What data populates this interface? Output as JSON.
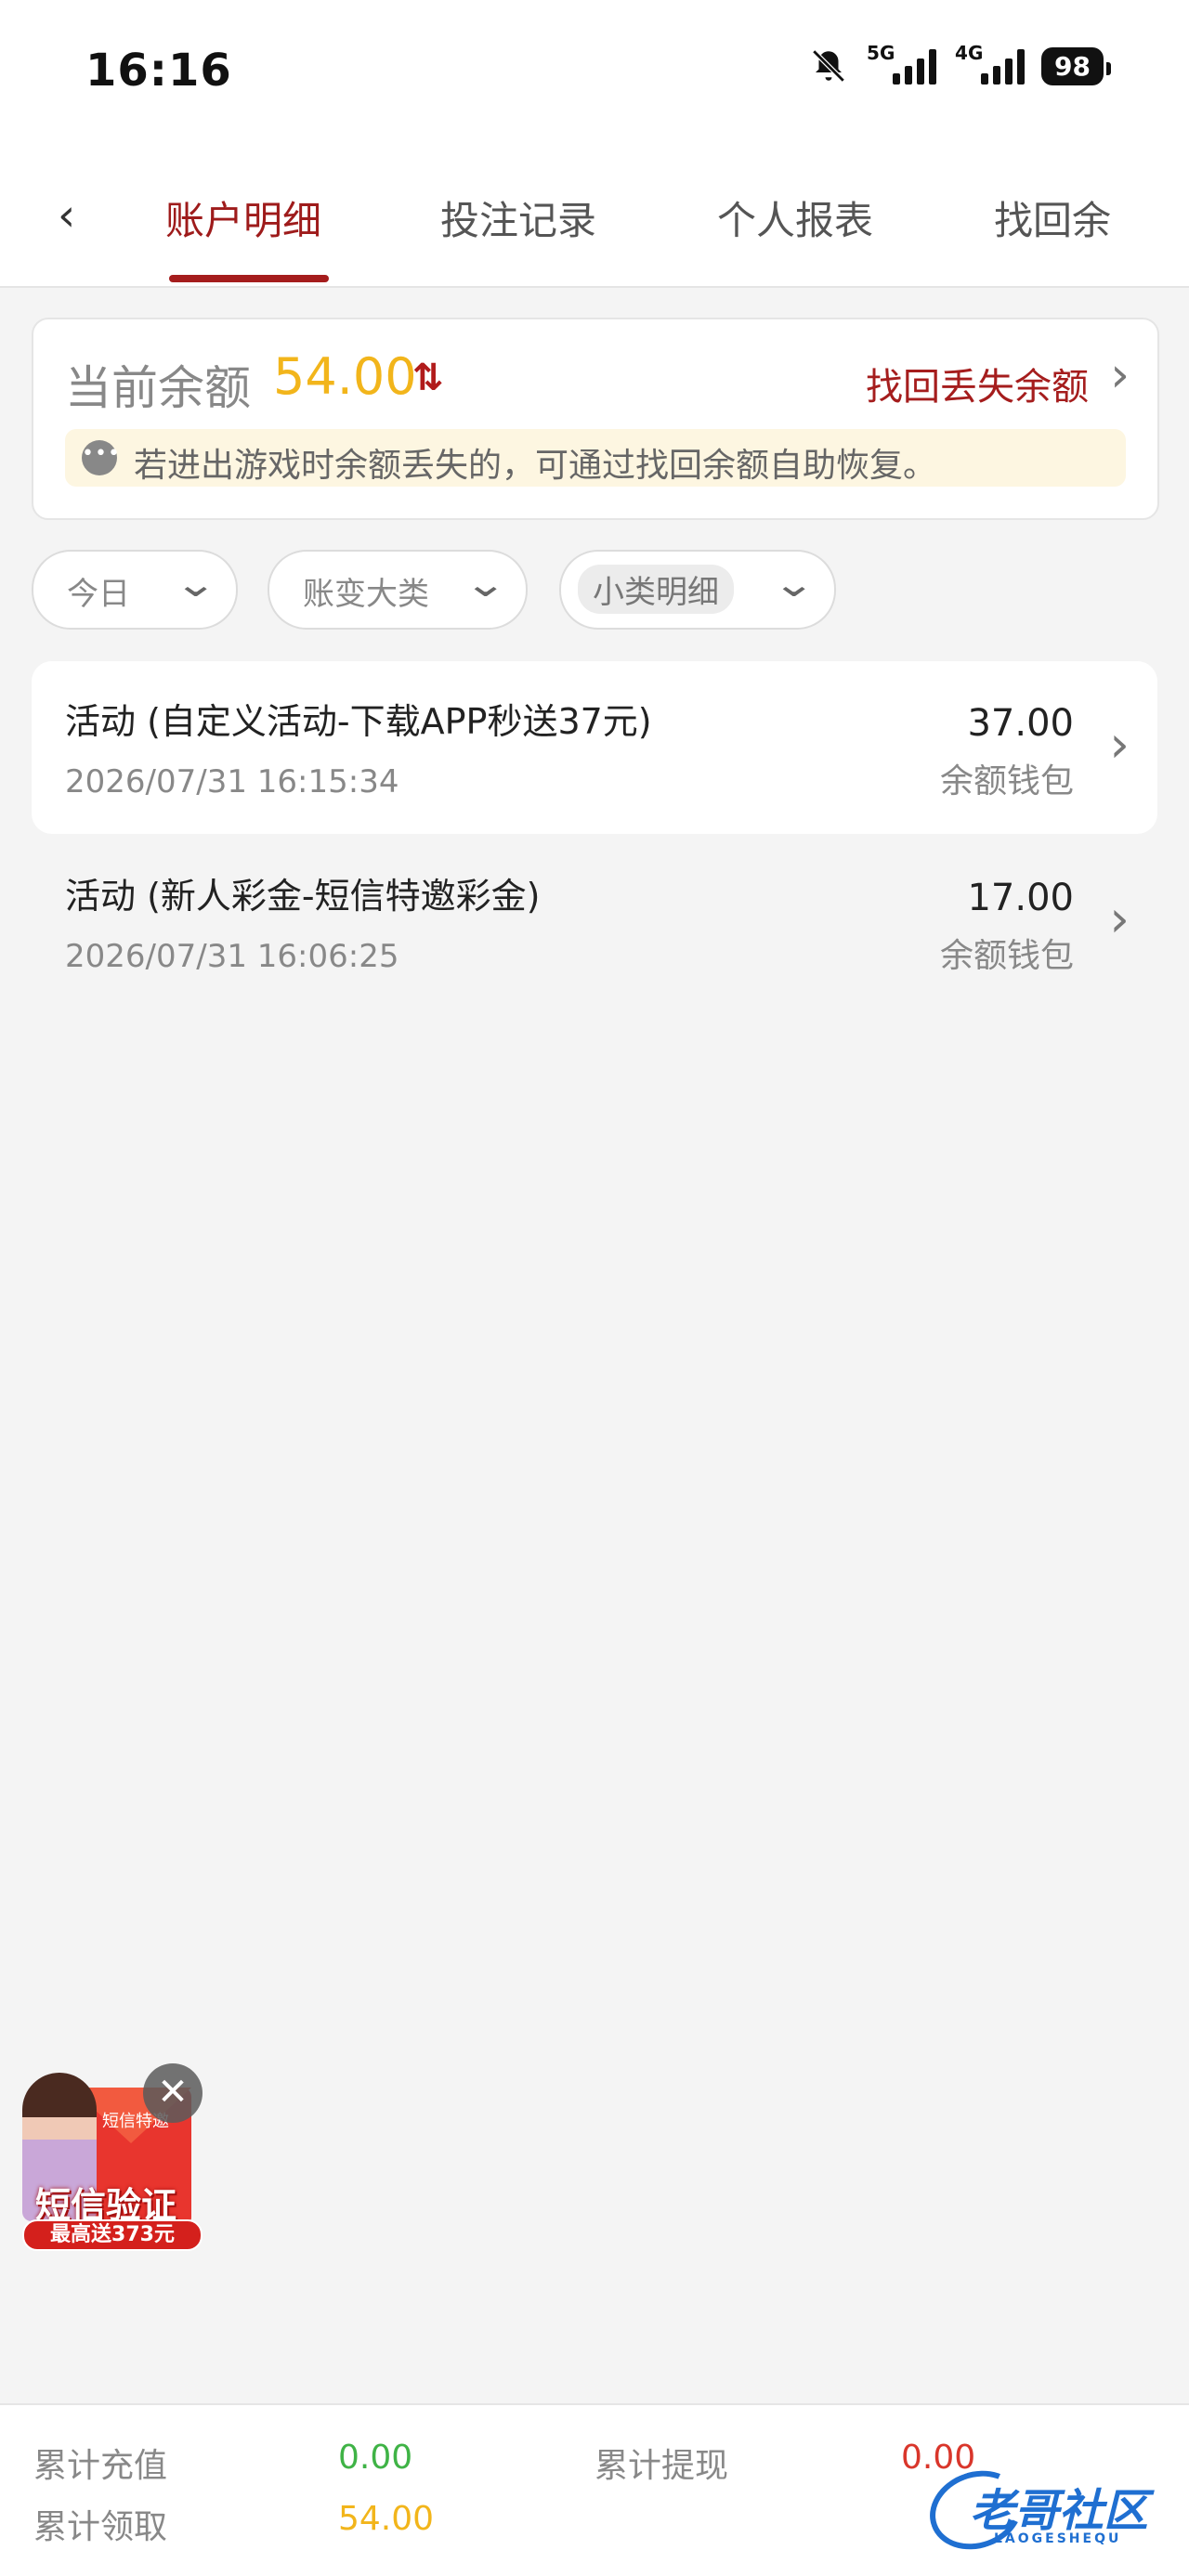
{
  "status_bar": {
    "time": "16:16",
    "net1": "5G",
    "net2": "4G",
    "battery": "98"
  },
  "tabs": {
    "back_icon": "chevron-left-icon",
    "items": [
      "账户明细",
      "投注记录",
      "个人报表",
      "找回余"
    ]
  },
  "balance": {
    "label": "当前余额",
    "value": "54.00",
    "recover_link": "找回丢失余额",
    "notice": "若进出游戏时余额丢失的，可通过找回余额自助恢复。"
  },
  "filters": [
    "今日",
    "账变大类",
    "小类明细"
  ],
  "records": [
    {
      "title": "活动 (自定义活动-下载APP秒送37元)",
      "date": "2026/07/31 16:15:34",
      "amount": "37.00",
      "wallet": "余额钱包"
    },
    {
      "title": "活动 (新人彩金-短信特邀彩金)",
      "date": "2026/07/31 16:06:25",
      "amount": "17.00",
      "wallet": "余额钱包"
    }
  ],
  "promo": {
    "tag": "短信特邀",
    "main": "短信验证",
    "sub": "最高送373元"
  },
  "summary": {
    "recharge_label": "累计充值",
    "recharge_value": "0.00",
    "withdraw_label": "累计提现",
    "withdraw_value": "0.00",
    "receive_label": "累计领取",
    "receive_value": "54.00"
  },
  "watermark": {
    "text": "老哥社区",
    "sub": "LAOGESHEQU"
  },
  "colors": {
    "accent": "#a51d1d",
    "balance": "#f2b51b",
    "positive": "#3fb346",
    "negative": "#d9362b"
  }
}
